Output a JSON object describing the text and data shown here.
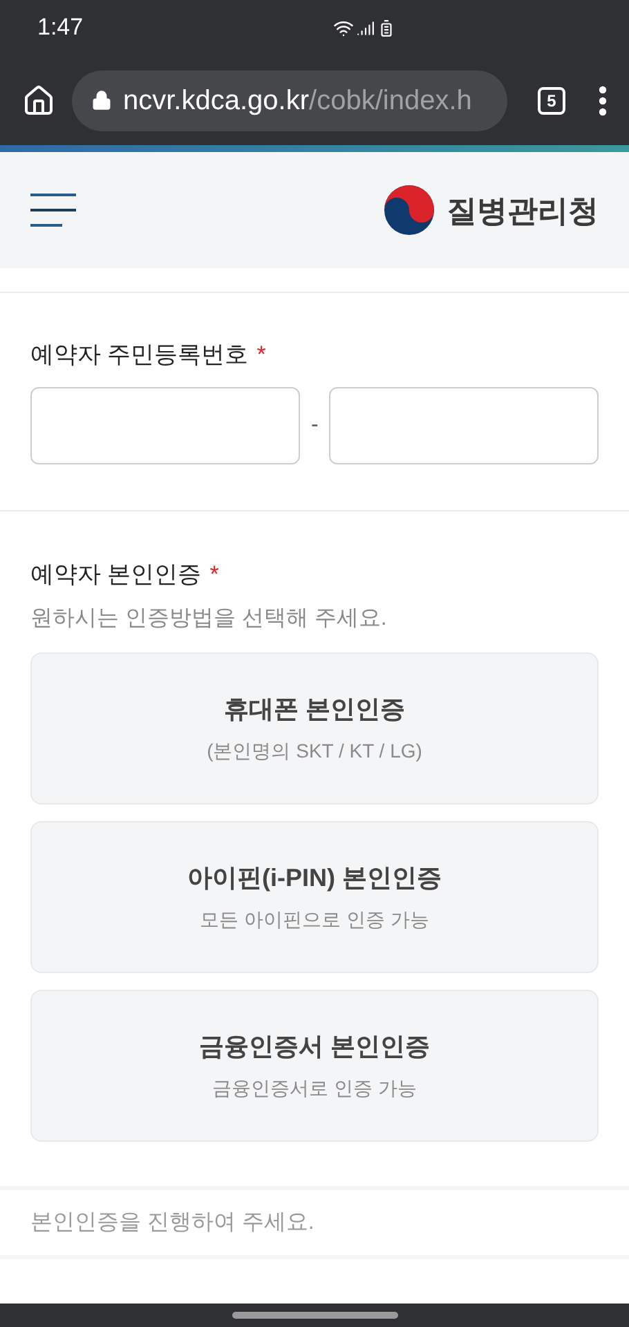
{
  "status_bar": {
    "time": "1:47"
  },
  "browser": {
    "url_host": "ncvr.kdca.go.kr",
    "url_path": "/cobk/index.h",
    "tab_count": "5"
  },
  "header": {
    "logo_text": "질병관리청"
  },
  "id_number": {
    "label": "예약자 주민등록번호",
    "required_mark": "*",
    "separator": "-"
  },
  "verification": {
    "label": "예약자 본인인증",
    "required_mark": "*",
    "hint": "원하시는 인증방법을 선택해 주세요.",
    "options": [
      {
        "title": "휴대폰 본인인증",
        "subtitle": "(본인명의 SKT / KT / LG)"
      },
      {
        "title": "아이핀(i-PIN) 본인인증",
        "subtitle": "모든 아이핀으로 인증 가능"
      },
      {
        "title": "금융인증서 본인인증",
        "subtitle": "금융인증서로 인증 가능"
      }
    ]
  },
  "status_message": "본인인증을 진행하여 주세요."
}
